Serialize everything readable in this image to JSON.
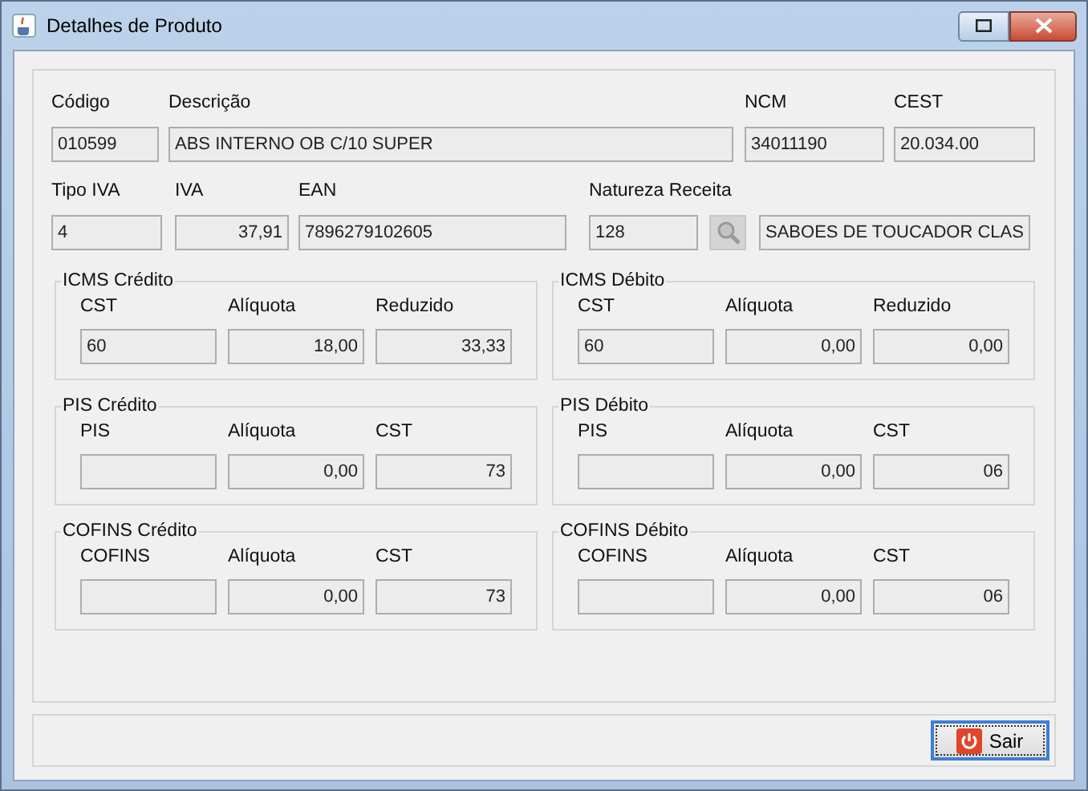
{
  "window": {
    "title": "Detalhes de Produto"
  },
  "rows": [
    [
      {
        "kind": "text",
        "label": "Código",
        "value": "010599"
      },
      {
        "kind": "text",
        "label": "Descrição",
        "value": "ABS INTERNO OB C/10 SUPER"
      },
      {
        "kind": "text",
        "label": "NCM",
        "value": "34011190"
      },
      {
        "kind": "text",
        "label": "CEST",
        "value": "20.034.00"
      }
    ],
    [
      {
        "kind": "text",
        "label": "Tipo IVA",
        "value": "4"
      },
      {
        "kind": "number",
        "label": "IVA",
        "value": "37,91"
      },
      {
        "kind": "text",
        "label": "EAN",
        "value": "7896279102605"
      },
      {
        "kind": "text",
        "label": "Natureza Receita",
        "value": "128"
      },
      {
        "kind": "lookup"
      },
      {
        "kind": "text",
        "value": "SABOES DE TOUCADOR CLAS"
      }
    ]
  ],
  "groups": [
    {
      "title": "ICMS Crédito",
      "fields": [
        {
          "kind": "text",
          "label": "CST",
          "value": "60"
        },
        {
          "kind": "number",
          "label": "Alíquota",
          "value": "18,00"
        },
        {
          "kind": "number",
          "label": "Reduzido",
          "value": "33,33"
        }
      ]
    },
    {
      "title": "ICMS Débito",
      "fields": [
        {
          "kind": "text",
          "label": "CST",
          "value": "60"
        },
        {
          "kind": "number",
          "label": "Alíquota",
          "value": "0,00"
        },
        {
          "kind": "number",
          "label": "Reduzido",
          "value": "0,00"
        }
      ]
    },
    {
      "title": "PIS Crédito",
      "fields": [
        {
          "kind": "text",
          "label": "PIS"
        },
        {
          "kind": "number",
          "label": "Alíquota",
          "value": "0,00"
        },
        {
          "kind": "number",
          "label": "CST",
          "value": "73"
        }
      ]
    },
    {
      "title": "PIS Débito",
      "fields": [
        {
          "kind": "text",
          "label": "PIS"
        },
        {
          "kind": "number",
          "label": "Alíquota",
          "value": "0,00"
        },
        {
          "kind": "number",
          "label": "CST",
          "value": "06"
        }
      ]
    },
    {
      "title": "COFINS Crédito",
      "fields": [
        {
          "kind": "text",
          "label": "COFINS"
        },
        {
          "kind": "number",
          "label": "Alíquota",
          "value": "0,00"
        },
        {
          "kind": "number",
          "label": "CST",
          "value": "73"
        }
      ]
    },
    {
      "title": "COFINS Débito",
      "fields": [
        {
          "kind": "text",
          "label": "COFINS"
        },
        {
          "kind": "number",
          "label": "Alíquota",
          "value": "0,00"
        },
        {
          "kind": "number",
          "label": "CST",
          "value": "06"
        }
      ]
    }
  ],
  "buttons": [
    {
      "label": "Sair",
      "focused": true
    }
  ]
}
